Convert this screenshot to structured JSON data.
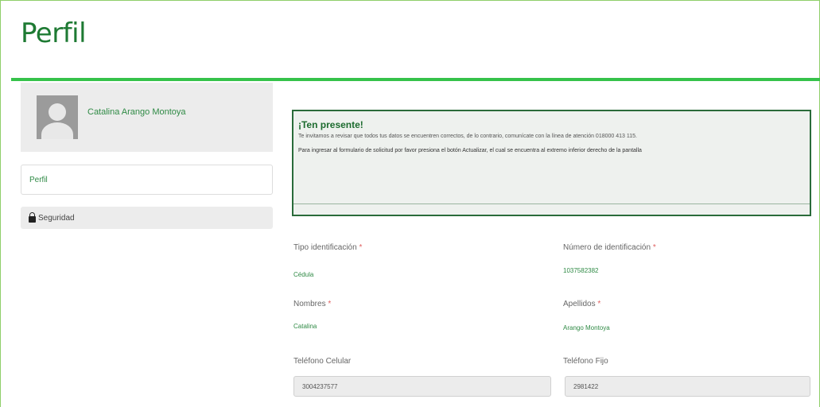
{
  "page": {
    "title": "Perfil"
  },
  "sidebar": {
    "user_name": "Catalina Arango Montoya",
    "items": [
      {
        "label": "Perfil",
        "icon": ""
      },
      {
        "label": "Seguridad",
        "icon": "lock-icon"
      }
    ]
  },
  "notice": {
    "title": "¡Ten presente!",
    "text1": "Te invitamos a revisar que todos tus datos se encuentren correctos, de lo contrario, comunícate con la línea de atención 018000 413 115.",
    "text2": "Para ingresar al formulario de solicitud por favor presiona el botón Actualizar, el cual se encuentra al extremo inferior derecho de la pantalla"
  },
  "form": {
    "tipo_identificacion": {
      "label": "Tipo identificación",
      "required_mark": "*",
      "value": "Cédula"
    },
    "numero_identificacion": {
      "label": "Número de identificación",
      "required_mark": "*",
      "value": "1037582382"
    },
    "nombres": {
      "label": "Nombres",
      "required_mark": "*",
      "value": "Catalina"
    },
    "apellidos": {
      "label": "Apellidos",
      "required_mark": "*",
      "value": "Arango Montoya"
    },
    "telefono_celular": {
      "label": "Teléfono Celular",
      "value": "3004237577"
    },
    "telefono_fijo": {
      "label": "Teléfono Fijo",
      "value": "2981422"
    }
  },
  "colors": {
    "brand_green": "#1e7a33",
    "accent_bar": "#35c24a",
    "required": "#e06060"
  }
}
